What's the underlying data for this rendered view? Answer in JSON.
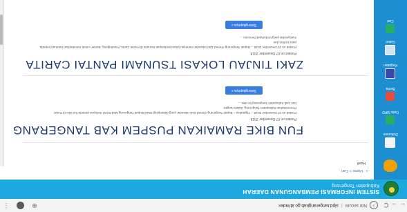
{
  "browser": {
    "back": "←",
    "forward": "→",
    "reload": "C",
    "info": "i",
    "security_label": "Not secure",
    "url": "sipd.tangerangkab.go.id/index",
    "zoom_icon": "⊕",
    "menu_icon": "⋮"
  },
  "header": {
    "title": "SISTEM INFORMASI PEMBANGUNAN DAERAH",
    "subtitle": "Kabupaten Tangerang",
    "bg_color": "#1ea8e0"
  },
  "breadcrumb": {
    "home_icon": "⌂",
    "text": "Home > Cari"
  },
  "sidebar": {
    "bg_color": "#1d8ed0",
    "items": [
      {
        "label": "",
        "icon": "hands-icon"
      },
      {
        "label": "Dokumen",
        "icon": "document-icon"
      },
      {
        "label": "Data SIPD",
        "icon": "database-icon"
      },
      {
        "label": "Berita",
        "icon": "news-icon"
      },
      {
        "label": "Kegiatan",
        "icon": "activity-icon"
      },
      {
        "label": "Galeri",
        "icon": "gallery-icon"
      },
      {
        "label": "Cari",
        "icon": "share-icon"
      }
    ]
  },
  "main": {
    "search_label": "Hasil",
    "results": [
      {
        "title": "FUN BIKE RAMAIKAN PUSPEM KAB TANGERANG",
        "meta": "Posted on 07 Desember 2018",
        "snippet": [
          "Posted on 07 Desember 2018 ... Tigaraksa – Bupati Tangerang Ahmed Zaki Iskandar yang didampingi Wakil Bupati Tangerang Mad Romli melepas peserta fun bike di Pusat Pemerintahan Kabupaten Tangerang, dalam rangka",
          "hari Jadi Kabupaten Tangerang ke-386 ..."
        ],
        "button": "Selengkapnya »"
      },
      {
        "title": "ZAKI TINJAU LOKASI TSUNAMI PANTAI CARITA",
        "meta": "Posted on 07 Desember 2018",
        "snippet": [
          "Posted on 23 Desember 2018 ... Bupati Tangerang Ahmed Zaki Iskandar meninjau lokasi terdampak tsunami di Pantai Carita, Pandeglang, Banten untuk memberikan bantuan kepada para korban dan",
          "masyarakat yang terdampak bencana ..."
        ],
        "button": "Selengkapnya »"
      }
    ]
  }
}
